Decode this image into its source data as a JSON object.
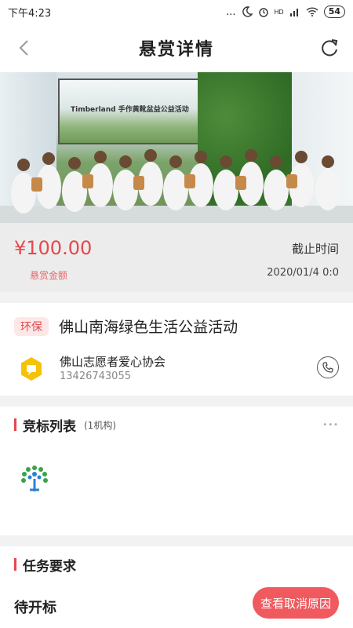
{
  "status_bar": {
    "time": "下午4:23",
    "signal_text": "...",
    "network": "HD",
    "battery": "54"
  },
  "header": {
    "title": "悬赏详情",
    "back_icon": "chevron-left-icon",
    "refresh_icon": "refresh-icon"
  },
  "hero": {
    "screen_caption": "Timberland 手作黄靴盆益公益活动",
    "alt": "volunteer group photo"
  },
  "reward": {
    "amount": "¥100.00",
    "amount_label": "悬赏金额",
    "deadline_label": "截止时间",
    "deadline": "2020/01/4 0:0"
  },
  "activity": {
    "tag": "环保",
    "title": "佛山南海绿色生活公益活动",
    "org_name": "佛山志愿者爱心协会",
    "org_phone": "13426743055"
  },
  "bids": {
    "heading": "竞标列表",
    "count": "(1机构)",
    "more": "•••"
  },
  "task": {
    "heading": "任务要求",
    "status": "待开标",
    "cancel_button": "查看取消原因"
  },
  "colors": {
    "accent": "#e5484d",
    "button": "#f05a5f",
    "badge": "#f5c20a"
  }
}
